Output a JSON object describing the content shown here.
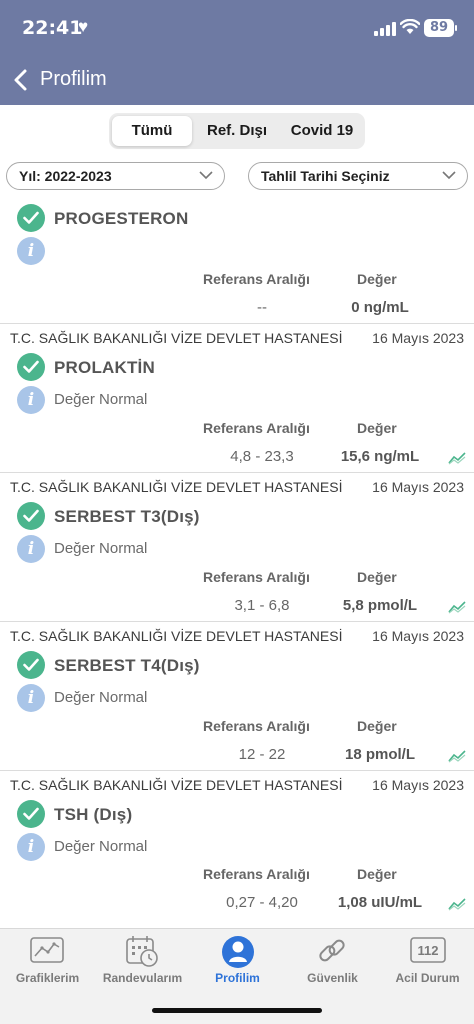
{
  "status_bar": {
    "time": "22:41",
    "battery": "89"
  },
  "nav": {
    "title": "Profilim"
  },
  "segments": [
    {
      "label": "Tümü",
      "active": true
    },
    {
      "label": "Ref. Dışı",
      "active": false
    },
    {
      "label": "Covid 19",
      "active": false
    }
  ],
  "filters": {
    "year": "Yıl: 2022-2023",
    "date": "Tahlil Tarihi Seçiniz"
  },
  "columns": {
    "reference": "Referans Aralığı",
    "value": "Değer"
  },
  "results": [
    {
      "name": "PROGESTERON",
      "hospital": "",
      "date": "",
      "status": "",
      "reference": "--",
      "value": "0 ng/mL"
    },
    {
      "name": "PROLAKTİN",
      "hospital": "T.C. SAĞLIK BAKANLIĞI VİZE DEVLET HASTANESİ",
      "date": "16 Mayıs 2023",
      "status": "Değer Normal",
      "reference": "4,8 - 23,3",
      "value": "15,6 ng/mL"
    },
    {
      "name": "SERBEST T3(Dış)",
      "hospital": "T.C. SAĞLIK BAKANLIĞI VİZE DEVLET HASTANESİ",
      "date": "16 Mayıs 2023",
      "status": "Değer Normal",
      "reference": "3,1 - 6,8",
      "value": "5,8 pmol/L"
    },
    {
      "name": "SERBEST T4(Dış)",
      "hospital": "T.C. SAĞLIK BAKANLIĞI VİZE DEVLET HASTANESİ",
      "date": "16 Mayıs 2023",
      "status": "Değer Normal",
      "reference": "12 - 22",
      "value": "18 pmol/L"
    },
    {
      "name": "TSH (Dış)",
      "hospital": "T.C. SAĞLIK BAKANLIĞI VİZE DEVLET HASTANESİ",
      "date": "16 Mayıs 2023",
      "status": "Değer Normal",
      "reference": "0,27 - 4,20",
      "value": "1,08 uIU/mL"
    }
  ],
  "tabbar": [
    {
      "label": "Grafiklerim",
      "icon": "chart-icon"
    },
    {
      "label": "Randevularım",
      "icon": "calendar-clock-icon"
    },
    {
      "label": "Profilim",
      "icon": "person-icon",
      "active": true
    },
    {
      "label": "Güvenlik",
      "icon": "link-icon"
    },
    {
      "label": "Acil Durum",
      "icon": "emergency-112-icon",
      "badge": "112"
    }
  ],
  "colors": {
    "header": "#6e7aa3",
    "check": "#4bb58d",
    "info": "#a9c5e8",
    "active_tab": "#2e73d8"
  }
}
